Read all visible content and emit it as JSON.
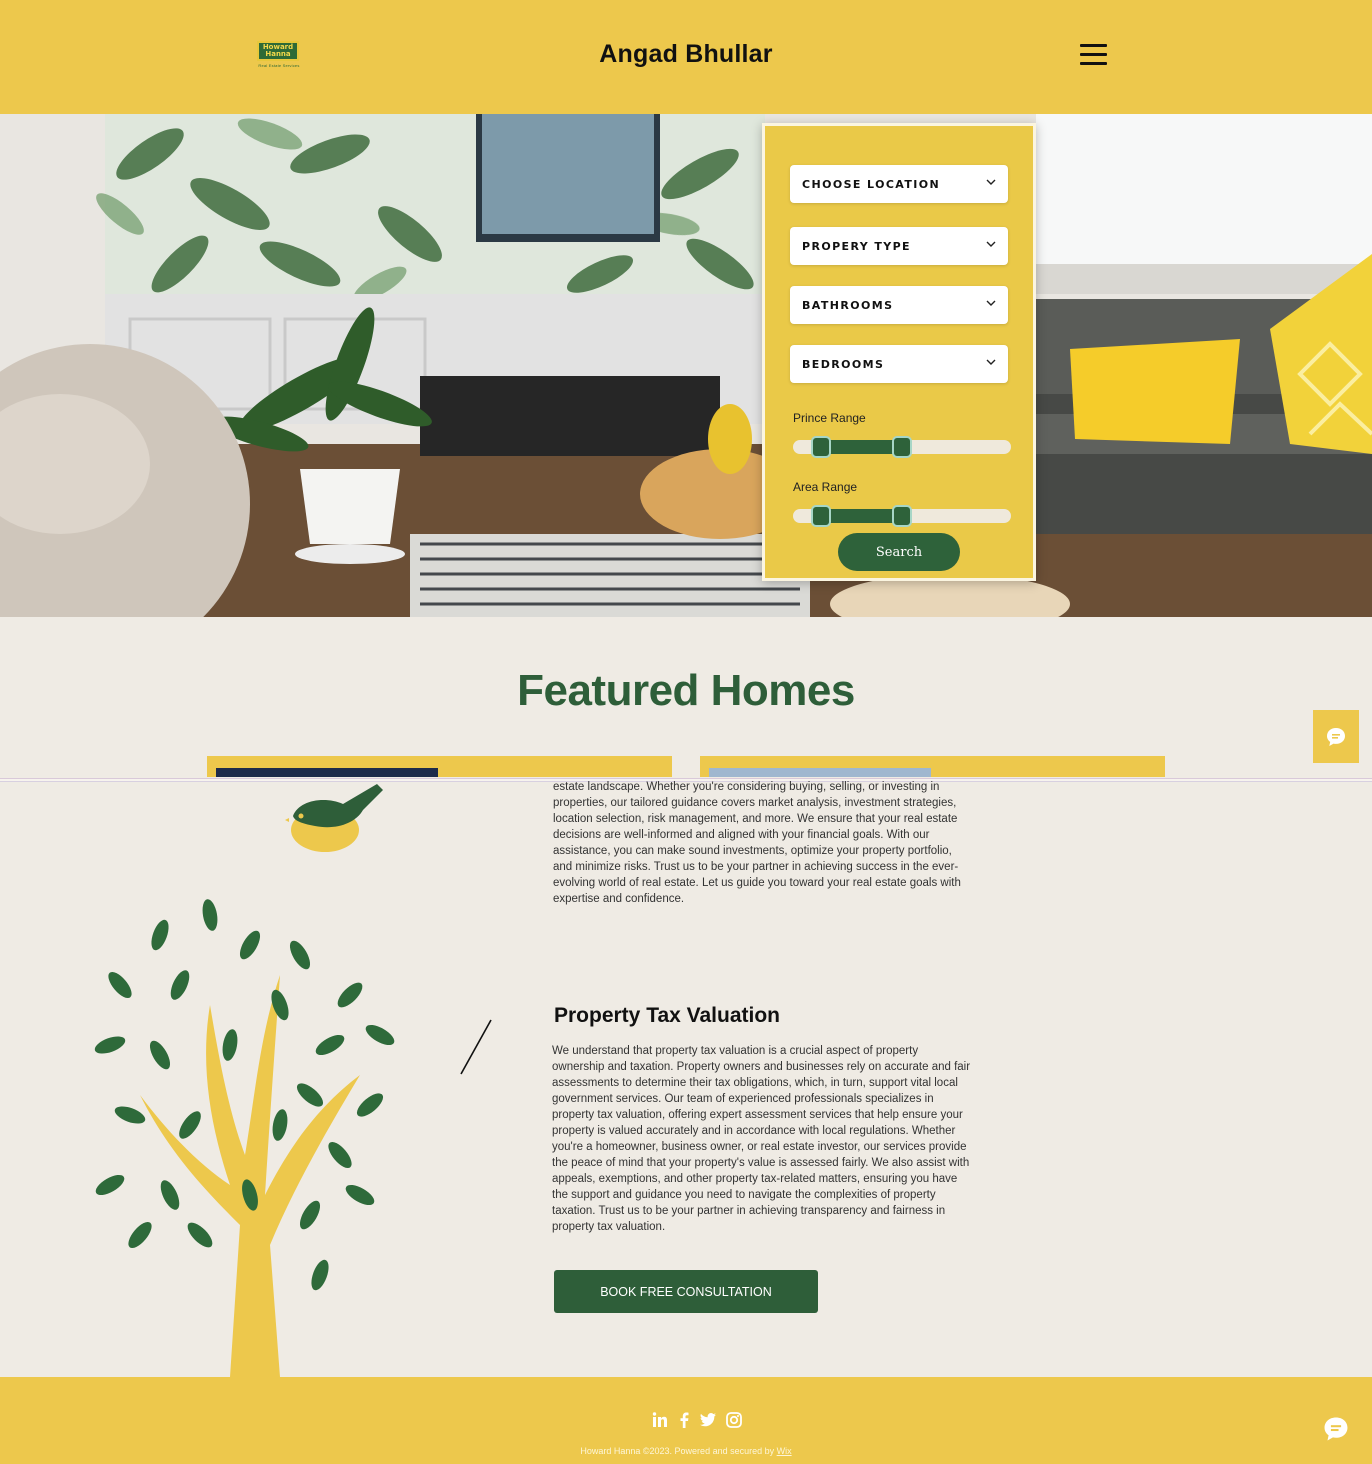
{
  "header": {
    "logo_line1": "Howard",
    "logo_line2": "Hanna",
    "logo_tagline": "Real Estate Services",
    "title": "Angad Bhullar",
    "menu_icon": "hamburger-menu-icon"
  },
  "search_panel": {
    "location_label": "CHOOSE LOCATION",
    "type_label": "PROPERY TYPE",
    "bathrooms_label": "BATHROOMS",
    "bedrooms_label": "BEDROOMS",
    "price_range_label": "Prince Range",
    "price_range": {
      "low": 0.13,
      "high": 0.5
    },
    "area_range_label": "Area Range",
    "area_range": {
      "low": 0.13,
      "high": 0.5
    },
    "search_label": "Search"
  },
  "featured": {
    "title": "Featured Homes"
  },
  "services": {
    "intro_text": "estate landscape. Whether you're considering buying, selling, or investing in properties, our tailored guidance covers market analysis, investment strategies, location selection, risk management, and more. We ensure that your real estate decisions are well-informed and aligned with your financial goals. With our assistance, you can make sound investments, optimize your property portfolio, and minimize risks. Trust us to be your partner in achieving success in the ever-evolving world of real estate. Let us guide you toward your real estate goals with expertise and confidence.",
    "heading": "Property Tax Valuation",
    "body": "We understand that property tax valuation is a crucial aspect of property ownership and taxation. Property owners and businesses rely on accurate and fair assessments to determine their tax obligations, which, in turn, support vital local government services. Our team of experienced professionals specializes in property tax valuation, offering expert assessment services that help ensure your property is valued accurately and in accordance with local regulations. Whether you're a homeowner, business owner, or real estate investor, our services provide the peace of mind that your property's value is assessed fairly. We also assist with appeals, exemptions, and other property tax-related matters, ensuring you have the support and guidance you need to navigate the complexities of property taxation. Trust us to be your partner in achieving transparency and fairness in property tax valuation.",
    "cta_label": "BOOK FREE CONSULTATION"
  },
  "footer": {
    "social": [
      "linkedin-icon",
      "facebook-icon",
      "twitter-icon",
      "instagram-icon"
    ],
    "copyright_text": "Howard Hanna ©2023. Powered and secured by ",
    "copyright_link": "Wix"
  },
  "colors": {
    "brand_yellow": "#edc84c",
    "brand_green": "#2e5e39",
    "background": "#efebe4"
  }
}
